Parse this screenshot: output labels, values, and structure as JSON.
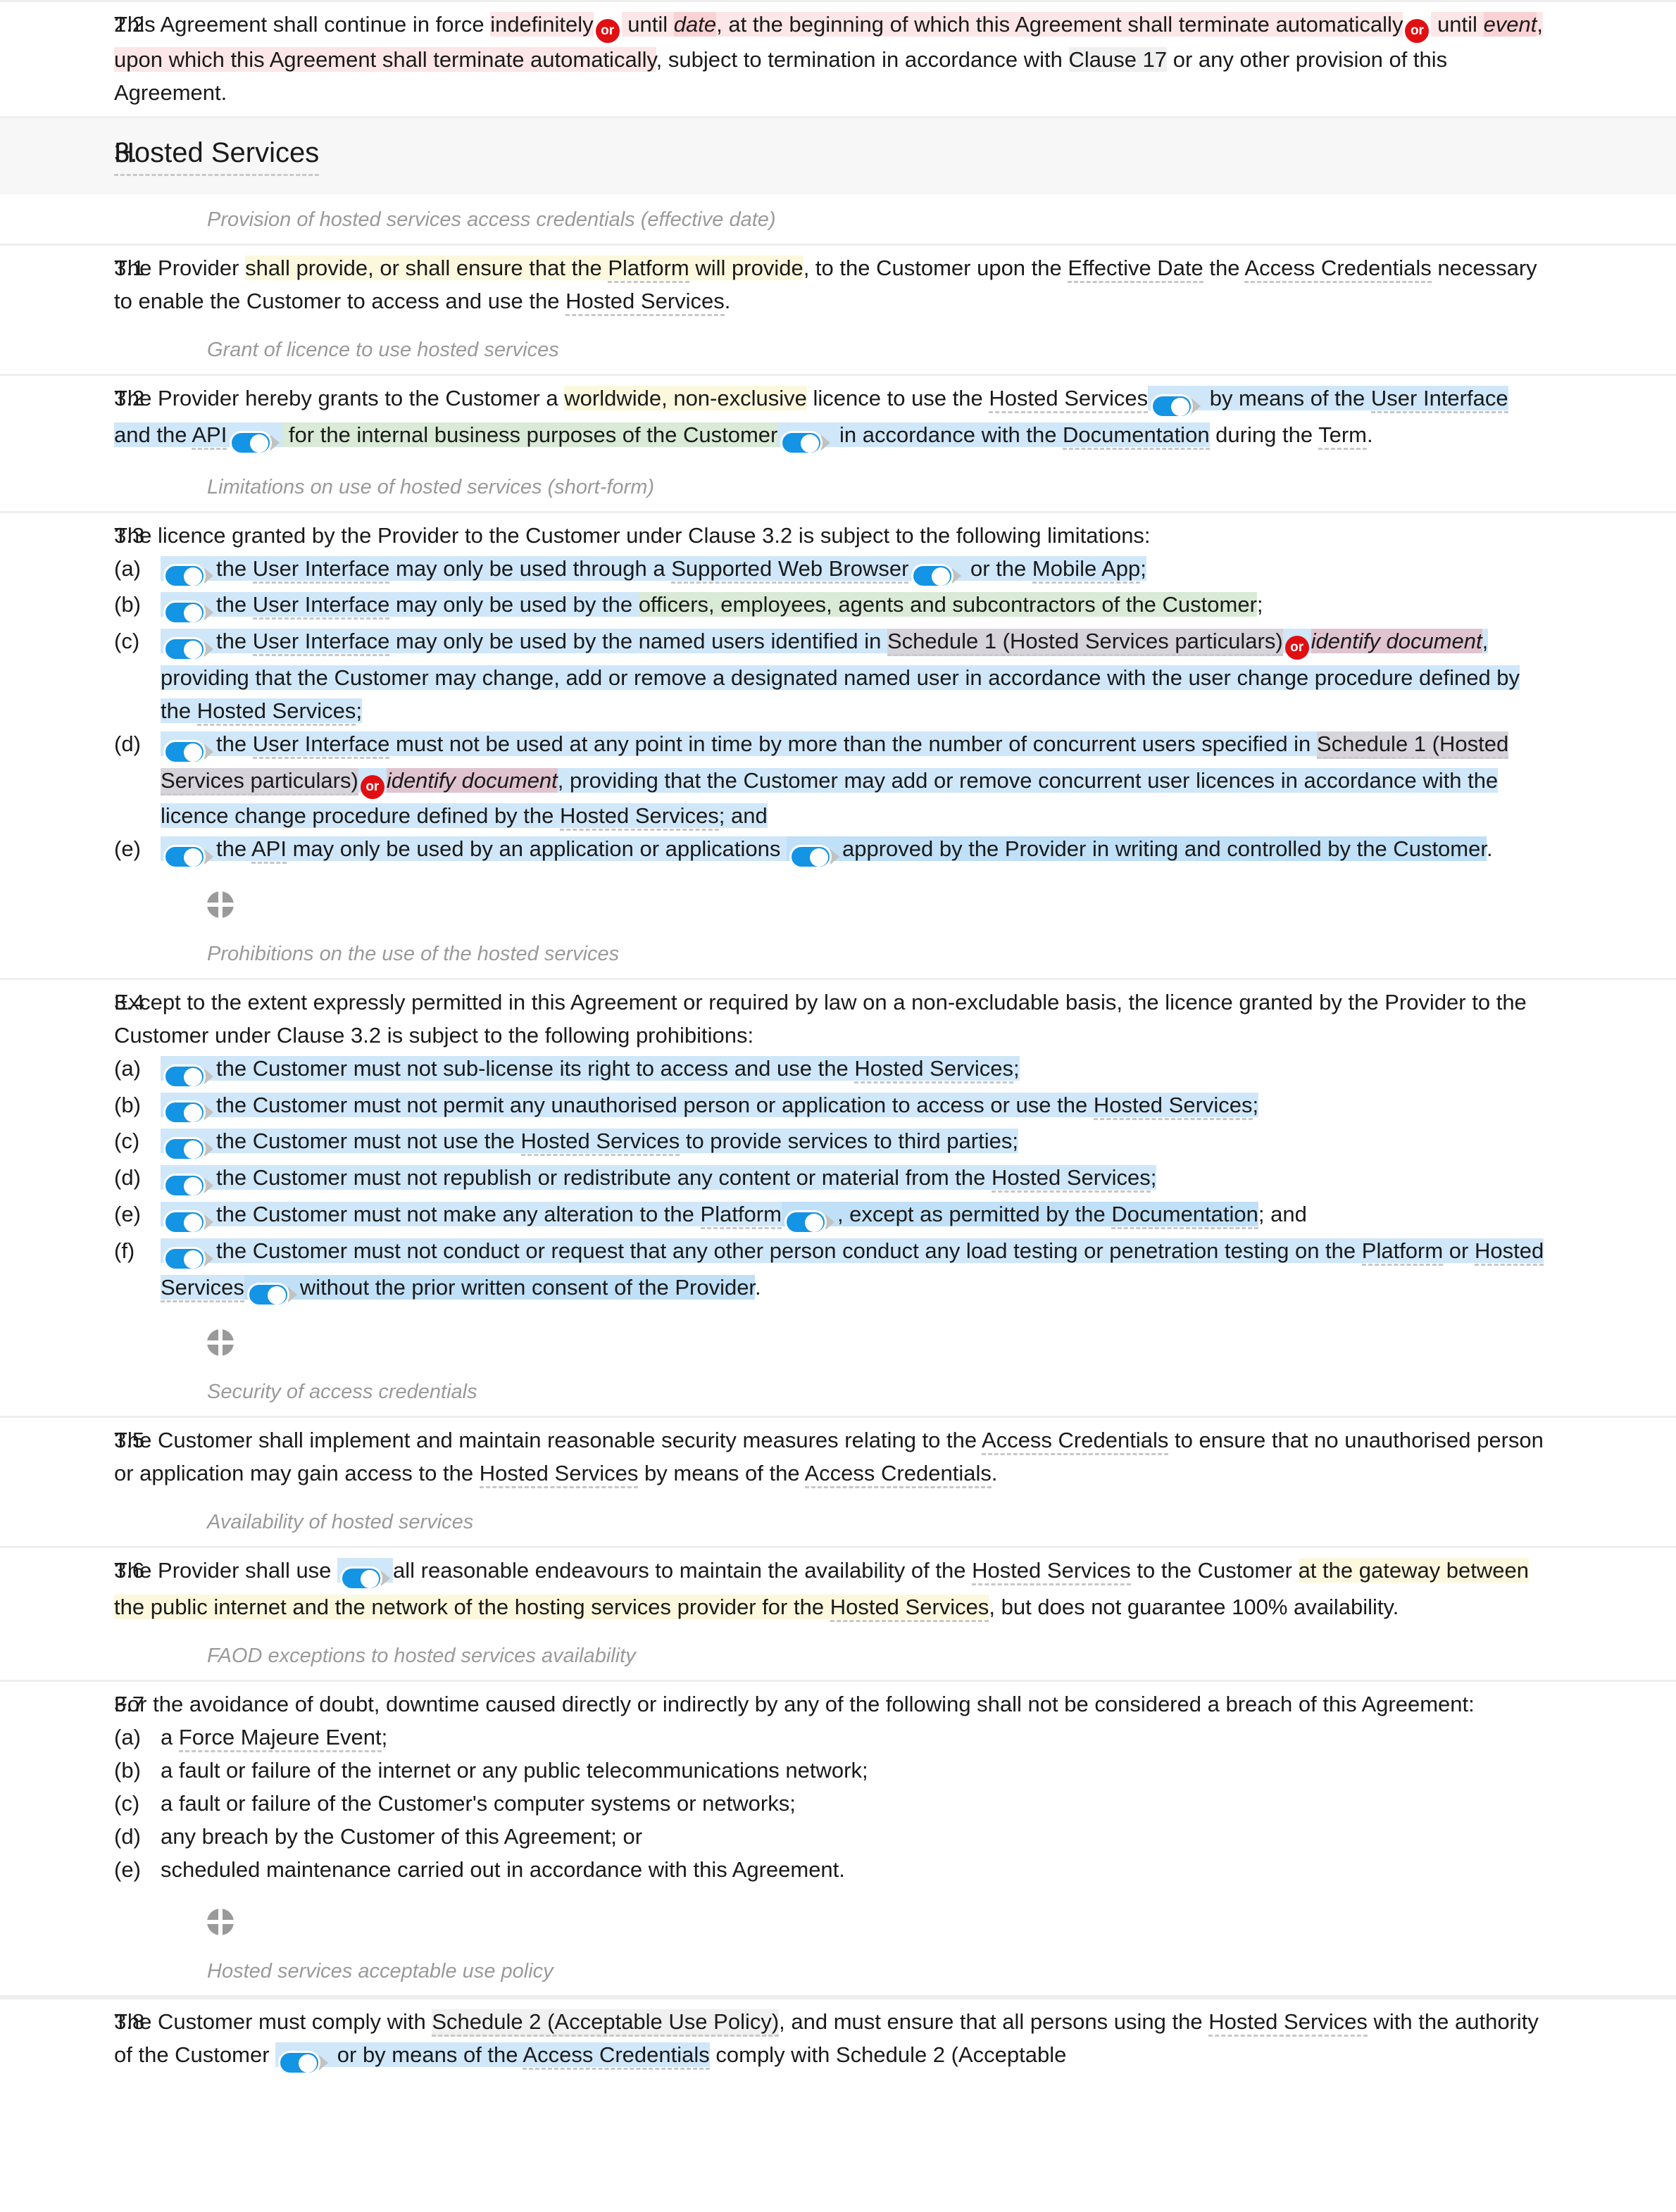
{
  "document": {
    "type": "legal-contract-editor",
    "section": {
      "number": "3.",
      "title": "Hosted Services"
    }
  },
  "colors": {
    "accent_toggle": "#1394e5",
    "or_badge": "#e10f12",
    "highlight_blue": "#cfe7f9",
    "highlight_green": "#d9ead7",
    "highlight_yellow": "#fbf8dd",
    "highlight_pink": "#fce6e7",
    "highlight_mauve": "#dfc4cf",
    "highlight_grey": "#f0f0f0",
    "guidance_text": "#9a9a9a"
  },
  "icons": {
    "or_badge_label": "or",
    "toggle_name": "toggle-switch-on",
    "handle_name": "move-handle-icon"
  },
  "clauses": {
    "c22": {
      "number": "2.2",
      "t1": "This Agreement shall continue in force ",
      "t2": "indefinitely",
      "t3": " until ",
      "t4": "date",
      "t5": ", at the beginning of which this Agreement shall terminate automatically",
      "t6": " until ",
      "t7": "event",
      "t8": ", upon which this Agreement shall terminate automatically",
      "t9": ", subject to termination in accordance with ",
      "t10": "Clause 17",
      "t11": " or any other provision of this Agreement."
    },
    "g31": "Provision of hosted services access credentials (effective date)",
    "c31": {
      "number": "3.1",
      "t1": "The Provider ",
      "t2": "shall provide, or shall ensure that the ",
      "t3": "Platform",
      "t4": " will provide",
      "t5": ", to the Customer upon the ",
      "t6": "Effective Date",
      "t7": " the ",
      "t8": "Access Credentials",
      "t9": " necessary to enable the Customer to access and use the ",
      "t10": "Hosted Services",
      "t11": "."
    },
    "g32": "Grant of licence to use hosted services",
    "c32": {
      "number": "3.2",
      "t1": "The Provider hereby grants to the Customer a ",
      "t2": "worldwide, non-exclusive",
      "t3": " licence to use the ",
      "t4": "Hosted Services",
      "t5": " by means of the ",
      "t6": "User Interface",
      "t7": " and the ",
      "t8": "API",
      "t9": " for the internal business purposes of the Customer",
      "t10": " in accordance with the ",
      "t11": "Documentation",
      "t12": " during the ",
      "t13": "Term",
      "t14": "."
    },
    "g33": "Limitations on use of hosted services (short-form)",
    "c33": {
      "number": "3.3",
      "lead": "The licence granted by the Provider to the Customer under Clause 3.2 is subject to the following limitations:",
      "items": [
        {
          "mark": "(a)",
          "p1": "the ",
          "p2": "User Interface",
          "p3": " may only be used through a ",
          "p4": "Supported Web Browser",
          "p5": " or the ",
          "p6": "Mobile App",
          "p7": ";"
        },
        {
          "mark": "(b)",
          "p1": "the ",
          "p2": "User Interface",
          "p3": " may only be used by the ",
          "p4": "officers, employees, agents and subcontractors of the Customer",
          "p5": ";"
        },
        {
          "mark": "(c)",
          "p1": "the ",
          "p2": "User Interface",
          "p3": " may only be used by the named users identified in ",
          "p4": "Schedule 1 (Hosted Services particulars)",
          "p5": "identify document",
          "p6": ", providing that the Customer may change, add or remove a designated named user in accordance with the user change procedure defined by the ",
          "p7": "Hosted Services",
          "p8": ";"
        },
        {
          "mark": "(d)",
          "p1": "the ",
          "p2": "User Interface",
          "p3": " must not be used at any point in time by more than the number of concurrent users specified in ",
          "p4": "Schedule 1 (Hosted Services particulars)",
          "p5": "identify document",
          "p6": ", providing that the Customer may add or remove concurrent user licences in accordance with the licence change procedure defined by the ",
          "p7": "Hosted Services",
          "p8": "; and"
        },
        {
          "mark": "(e)",
          "p1": "the ",
          "p2": "API",
          "p3": " may only be used by an application or applications ",
          "p4": "approved by the Provider in writing and controlled by the Customer",
          "p5": "."
        }
      ]
    },
    "g34": "Prohibitions on the use of the hosted services",
    "c34": {
      "number": "3.4",
      "lead": "Except to the extent expressly permitted in this Agreement or required by law on a non-excludable basis, the licence granted by the Provider to the Customer under Clause 3.2 is subject to the following prohibitions:",
      "items": [
        {
          "mark": "(a)",
          "p1": "the Customer must not sub-license its right to access and use the ",
          "p2": "Hosted Services",
          "p3": ";"
        },
        {
          "mark": "(b)",
          "p1": "the Customer must not permit any unauthorised person or application to access or use the ",
          "p2": "Hosted Services",
          "p3": ";"
        },
        {
          "mark": "(c)",
          "p1": "the Customer must not use the ",
          "p2": "Hosted Services",
          "p3": " to provide services to third parties;"
        },
        {
          "mark": "(d)",
          "p1": "the Customer must not republish or redistribute any content or material from the ",
          "p2": "Hosted Services",
          "p3": ";"
        },
        {
          "mark": "(e)",
          "p1": "the Customer must not make any alteration to the ",
          "p2": "Platform",
          "p3": ", except as permitted by the ",
          "p4": "Documentation",
          "p5": "; and"
        },
        {
          "mark": "(f)",
          "p1": "the Customer must not conduct or request that any other person conduct any load testing or penetration testing on the ",
          "p2": "Platform",
          "p3": " or ",
          "p4": "Hosted Services",
          "p5": "without the prior written consent of the Provider",
          "p6": "."
        }
      ]
    },
    "g35": "Security of access credentials",
    "c35": {
      "number": "3.5",
      "t1": "The Customer shall implement and maintain reasonable security measures relating to the ",
      "t2": "Access Credentials",
      "t3": " to ensure that no unauthorised person or application may gain access to the ",
      "t4": "Hosted Services",
      "t5": " by means of the ",
      "t6": "Access Credentials",
      "t7": "."
    },
    "g36": "Availability of hosted services",
    "c36": {
      "number": "3.6",
      "t1": "The Provider shall use ",
      "t2": "all reasonable endeavours to maintain the availability of the ",
      "t3": "Hosted Services",
      "t4": " to the Customer ",
      "t5": "at the gateway between the public internet and the network of the hosting services provider for the ",
      "t6": "Hosted Services",
      "t7": ", but does not guarantee 100% availability."
    },
    "g37": "FAOD exceptions to hosted services availability",
    "c37": {
      "number": "3.7",
      "lead": "For the avoidance of doubt, downtime caused directly or indirectly by any of the following shall not be considered a breach of this Agreement:",
      "items": [
        {
          "mark": "(a)",
          "p1": "a ",
          "p2": "Force Majeure Event",
          "p3": ";"
        },
        {
          "mark": "(b)",
          "p1": "a fault or failure of the internet or any public telecommunications network;",
          "p2": "",
          "p3": ""
        },
        {
          "mark": "(c)",
          "p1": "a fault or failure of the Customer's computer systems or networks;",
          "p2": "",
          "p3": ""
        },
        {
          "mark": "(d)",
          "p1": "any breach by the Customer of this Agreement; or",
          "p2": "",
          "p3": ""
        },
        {
          "mark": "(e)",
          "p1": "scheduled maintenance carried out in accordance with this Agreement.",
          "p2": "",
          "p3": ""
        }
      ]
    },
    "g38": "Hosted services acceptable use policy",
    "c38": {
      "number": "3.8",
      "t1": "The Customer must comply with ",
      "t2": "Schedule 2 (Acceptable Use Policy)",
      "t3": ", and must ensure that all persons using the ",
      "t4": "Hosted Services",
      "t5": " with the authority of the Customer ",
      "t6": " or by means of the ",
      "t7": "Access Credentials",
      "t8": " comply with Schedule 2 (Acceptable"
    }
  }
}
